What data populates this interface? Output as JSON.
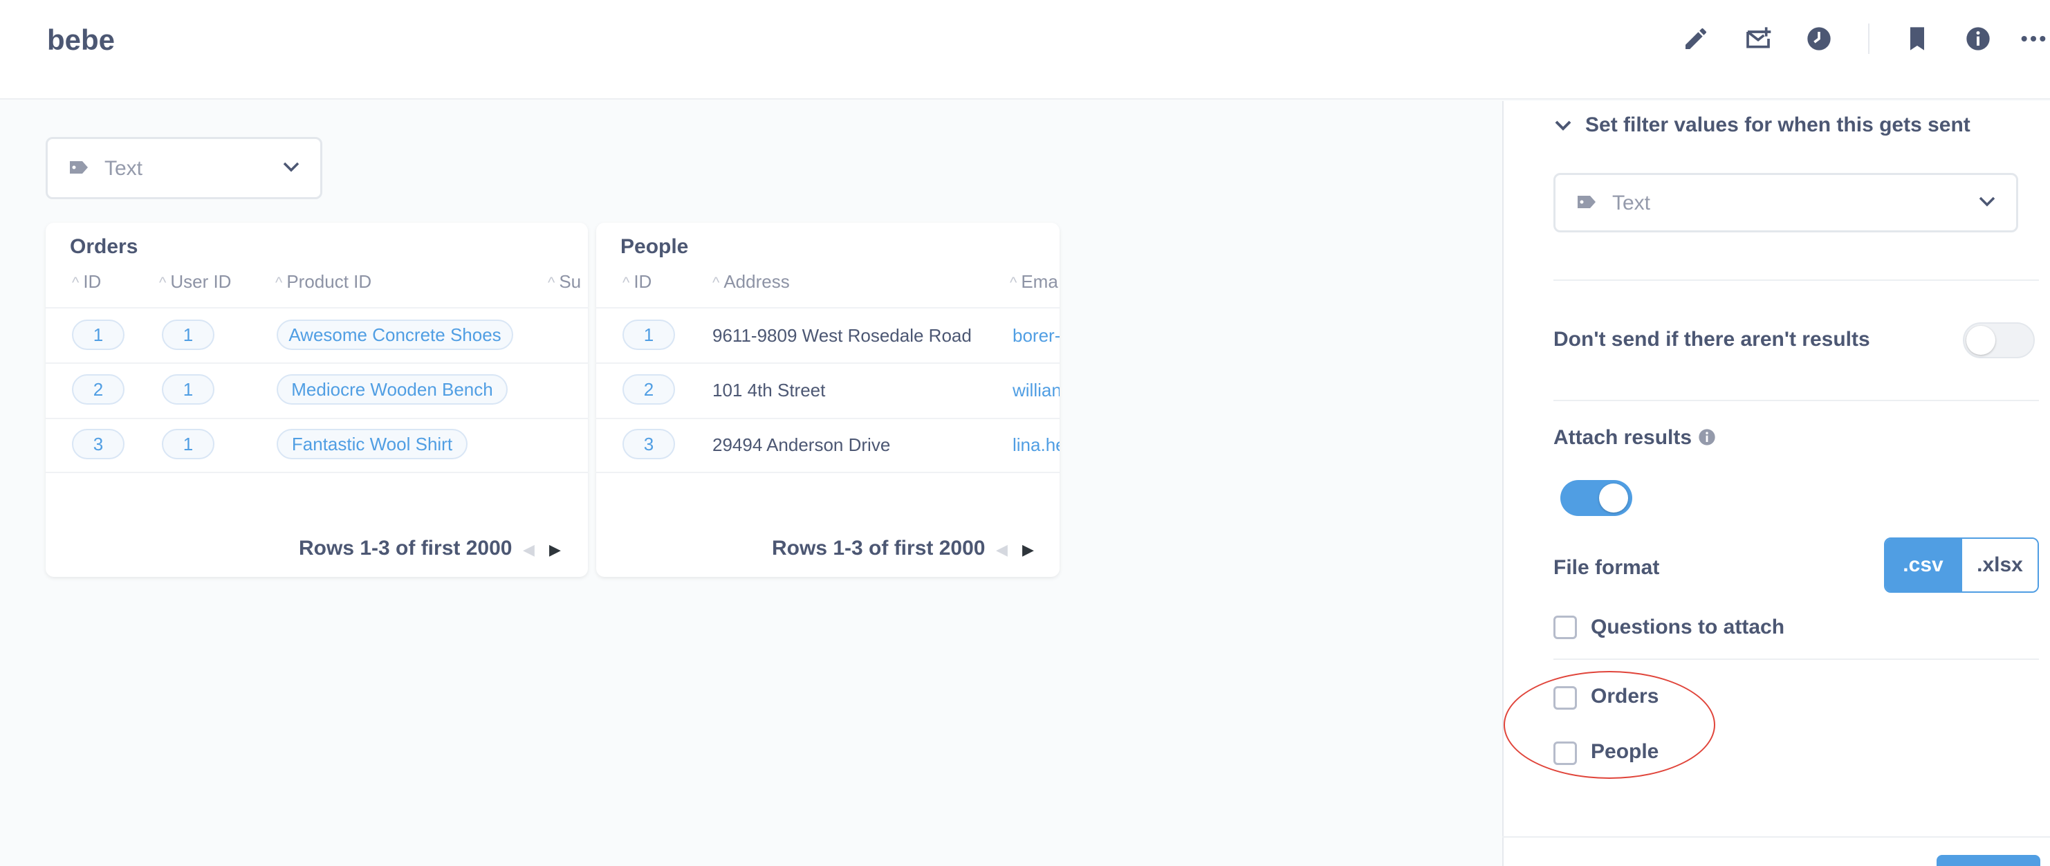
{
  "header": {
    "title": "bebe",
    "icons": [
      "pencil-icon",
      "mail-plus-icon",
      "clock-icon",
      "bookmark-icon",
      "info-icon",
      "more-icon"
    ]
  },
  "filter": {
    "label": "Text",
    "icon": "tag-icon"
  },
  "cards": {
    "orders": {
      "title": "Orders",
      "columns": [
        "ID",
        "User ID",
        "Product ID",
        "Su"
      ],
      "rows": [
        {
          "id": "1",
          "user_id": "1",
          "product": "Awesome Concrete Shoes"
        },
        {
          "id": "2",
          "user_id": "1",
          "product": "Mediocre Wooden Bench"
        },
        {
          "id": "3",
          "user_id": "1",
          "product": "Fantastic Wool Shirt"
        }
      ],
      "pager": "Rows 1-3 of first 2000"
    },
    "people": {
      "title": "People",
      "columns": [
        "ID",
        "Address",
        "Ema"
      ],
      "rows": [
        {
          "id": "1",
          "address": "9611-9809 West Rosedale Road",
          "email": "borer-"
        },
        {
          "id": "2",
          "address": "101 4th Street",
          "email": "willian"
        },
        {
          "id": "3",
          "address": "29494 Anderson Drive",
          "email": "lina.he"
        }
      ],
      "pager": "Rows 1-3 of first 2000"
    }
  },
  "sidebar": {
    "filter_section_label": "Set filter values for when this gets sent",
    "filter_select_label": "Text",
    "dont_send_label": "Don't send if there aren't results",
    "dont_send_on": false,
    "attach_results_label": "Attach results",
    "attach_results_on": true,
    "file_format_label": "File format",
    "formats": [
      ".csv",
      ".xlsx"
    ],
    "selected_format": ".csv",
    "questions_label": "Questions to attach",
    "questions": [
      {
        "label": "Orders",
        "checked": false
      },
      {
        "label": "People",
        "checked": false
      }
    ]
  },
  "colors": {
    "brand": "#509ee3",
    "text": "#4c5773",
    "muted": "#949aab",
    "annotation": "#e0443a"
  }
}
